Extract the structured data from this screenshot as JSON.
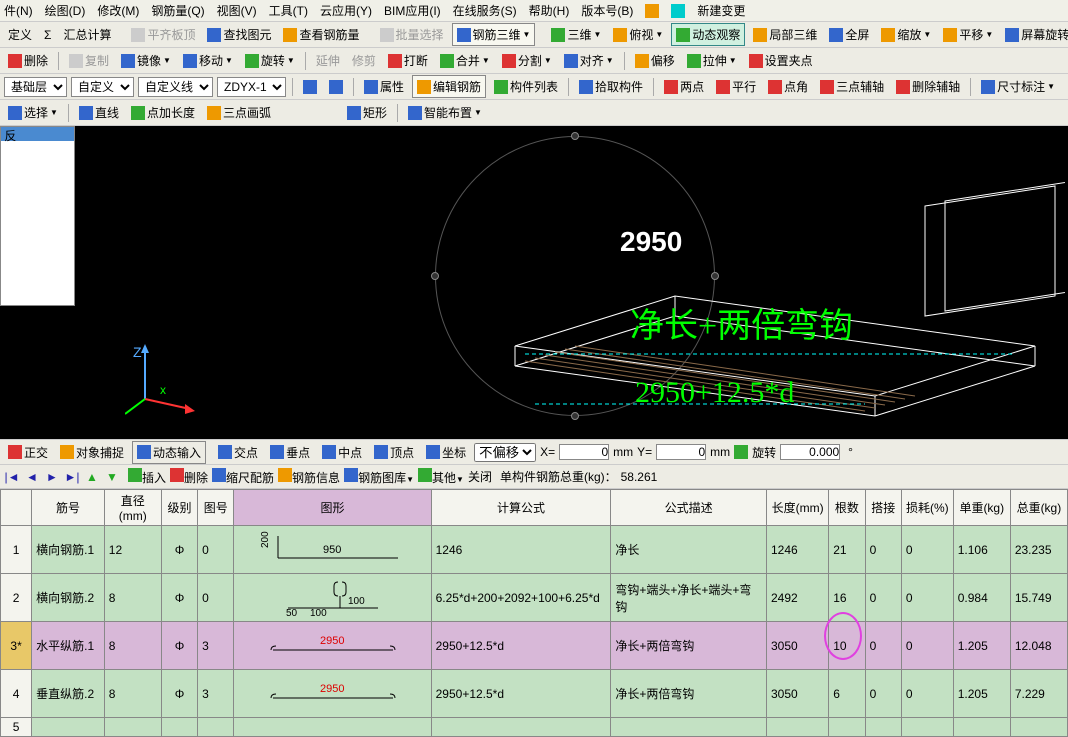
{
  "menu": {
    "items": [
      "件(N)",
      "绘图(D)",
      "修改(M)",
      "钢筋量(Q)",
      "视图(V)",
      "工具(T)",
      "云应用(Y)",
      "BIM应用(I)",
      "在线服务(S)",
      "帮助(H)",
      "版本号(B)",
      "新建变更"
    ]
  },
  "toolbar1": {
    "define": "定义",
    "sigma": "Σ",
    "summary": "汇总计算",
    "flatTop": "平齐板顶",
    "findDwg": "查找图元",
    "viewRebar": "查看钢筋量",
    "batchSel": "批量选择",
    "rebar3d": "钢筋三维",
    "threeD": "三维",
    "topView": "俯视",
    "dynView": "动态观察",
    "local3d": "局部三维",
    "fullScreen": "全屏",
    "zoom": "缩放",
    "pan": "平移",
    "screenRot": "屏幕旋转"
  },
  "toolbar2": {
    "delete": "删除",
    "copy": "复制",
    "mirror": "镜像",
    "move": "移动",
    "rotate": "旋转",
    "extend": "延伸",
    "trim": "修剪",
    "break": "打断",
    "merge": "合并",
    "split": "分割",
    "align": "对齐",
    "offset": "偏移",
    "stretch": "拉伸",
    "gripPt": "设置夹点"
  },
  "toolbar3": {
    "layer": "基础层",
    "custom": "自定义",
    "customLine": "自定义线",
    "code": "ZDYX-1",
    "props": "属性",
    "editRebar": "编辑钢筋",
    "compList": "构件列表",
    "pickComp": "拾取构件",
    "twoPt": "两点",
    "parallel": "平行",
    "ptAngle": "点角",
    "threePtAux": "三点辅轴",
    "delAux": "删除辅轴",
    "dimAnno": "尺寸标注"
  },
  "toolbar4": {
    "select": "选择",
    "line": "直线",
    "ptLen": "点加长度",
    "arc3pt": "三点画弧",
    "rect": "矩形",
    "smartLayout": "智能布置"
  },
  "statusbar": {
    "ortho": "正交",
    "osnap": "对象捕捉",
    "dynInput": "动态输入",
    "intersect": "交点",
    "perp": "垂点",
    "midpt": "中点",
    "vertex": "顶点",
    "coord": "坐标",
    "noOffset": "不偏移",
    "x": "X=",
    "xval": "0",
    "xmm": "mm",
    "y": "Y=",
    "yval": "0",
    "ymm": "mm",
    "rotLbl": "旋转",
    "rotVal": "0.000"
  },
  "navbar": {
    "insert": "插入",
    "delete": "删除",
    "scaleRebar": "缩尺配筋",
    "rebarInfo": "钢筋信息",
    "rebarLib": "钢筋图库",
    "other": "其他",
    "close": "关闭",
    "totalLabel": "单构件钢筋总重(kg)：",
    "totalVal": "58.261"
  },
  "canvas": {
    "dim": "2950",
    "note1": "净长+两倍弯钩",
    "note2": "2950+12.5*d",
    "axisZ": "Z",
    "axisX": "x"
  },
  "table": {
    "headers": [
      "",
      "筋号",
      "直径(mm)",
      "级别",
      "图号",
      "图形",
      "计算公式",
      "公式描述",
      "长度(mm)",
      "根数",
      "搭接",
      "损耗(%)",
      "单重(kg)",
      "总重(kg)"
    ],
    "rows": [
      {
        "n": "1",
        "name": "横向钢筋.1",
        "dia": "12",
        "grade": "Φ",
        "fig": "0",
        "shapeDim": "950",
        "shapeDim2": "200",
        "formula": "1246",
        "desc": "净长",
        "len": "1246",
        "count": "21",
        "lap": "0",
        "loss": "0",
        "unit": "1.106",
        "total": "23.235"
      },
      {
        "n": "2",
        "name": "横向钢筋.2",
        "dia": "8",
        "grade": "Φ",
        "fig": "0",
        "shapeDim": "100",
        "shapeDim2": "50",
        "shapeDim3": "100",
        "formula": "6.25*d+200+2092+100+6.25*d",
        "desc": "弯钩+端头+净长+端头+弯钩",
        "len": "2492",
        "count": "16",
        "lap": "0",
        "loss": "0",
        "unit": "0.984",
        "total": "15.749"
      },
      {
        "n": "3*",
        "name": "水平纵筋.1",
        "dia": "8",
        "grade": "Φ",
        "fig": "3",
        "shapeDim": "2950",
        "formula": "2950+12.5*d",
        "desc": "净长+两倍弯钩",
        "len": "3050",
        "count": "10",
        "lap": "0",
        "loss": "0",
        "unit": "1.205",
        "total": "12.048",
        "selected": true
      },
      {
        "n": "4",
        "name": "垂直纵筋.2",
        "dia": "8",
        "grade": "Φ",
        "fig": "3",
        "shapeDim": "2950",
        "formula": "2950+12.5*d",
        "desc": "净长+两倍弯钩",
        "len": "3050",
        "count": "6",
        "lap": "0",
        "loss": "0",
        "unit": "1.205",
        "total": "7.229"
      },
      {
        "n": "5",
        "name": "",
        "dia": "",
        "grade": "",
        "fig": "",
        "formula": "",
        "desc": "",
        "len": "",
        "count": "",
        "lap": "",
        "loss": "",
        "unit": "",
        "total": ""
      }
    ]
  }
}
